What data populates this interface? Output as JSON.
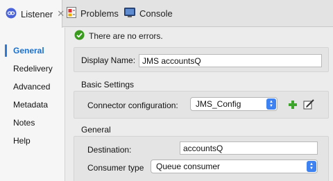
{
  "tabs": [
    {
      "label": "Listener",
      "icon": "listener-icon",
      "active": true
    },
    {
      "label": "Problems",
      "icon": "problems-icon",
      "active": false
    },
    {
      "label": "Console",
      "icon": "console-icon",
      "active": false
    }
  ],
  "nav": {
    "items": [
      "General",
      "Redelivery",
      "Advanced",
      "Metadata",
      "Notes",
      "Help"
    ],
    "selected": "General"
  },
  "status": {
    "text": "There are no errors.",
    "icon": "check-circle-icon",
    "color": "#3a9a1f"
  },
  "form": {
    "display_name_label": "Display Name:",
    "display_name_value": "JMS accountsQ",
    "basic_settings_title": "Basic Settings",
    "connector_config_label": "Connector configuration:",
    "connector_config_value": "JMS_Config",
    "general_title": "General",
    "destination_label": "Destination:",
    "destination_value": "accountsQ",
    "consumer_type_label": "Consumer type",
    "consumer_type_value": "Queue consumer"
  },
  "colors": {
    "accent": "#2e7bd6",
    "select_arrow": "#3d82f0",
    "add_green": "#3da52b"
  }
}
